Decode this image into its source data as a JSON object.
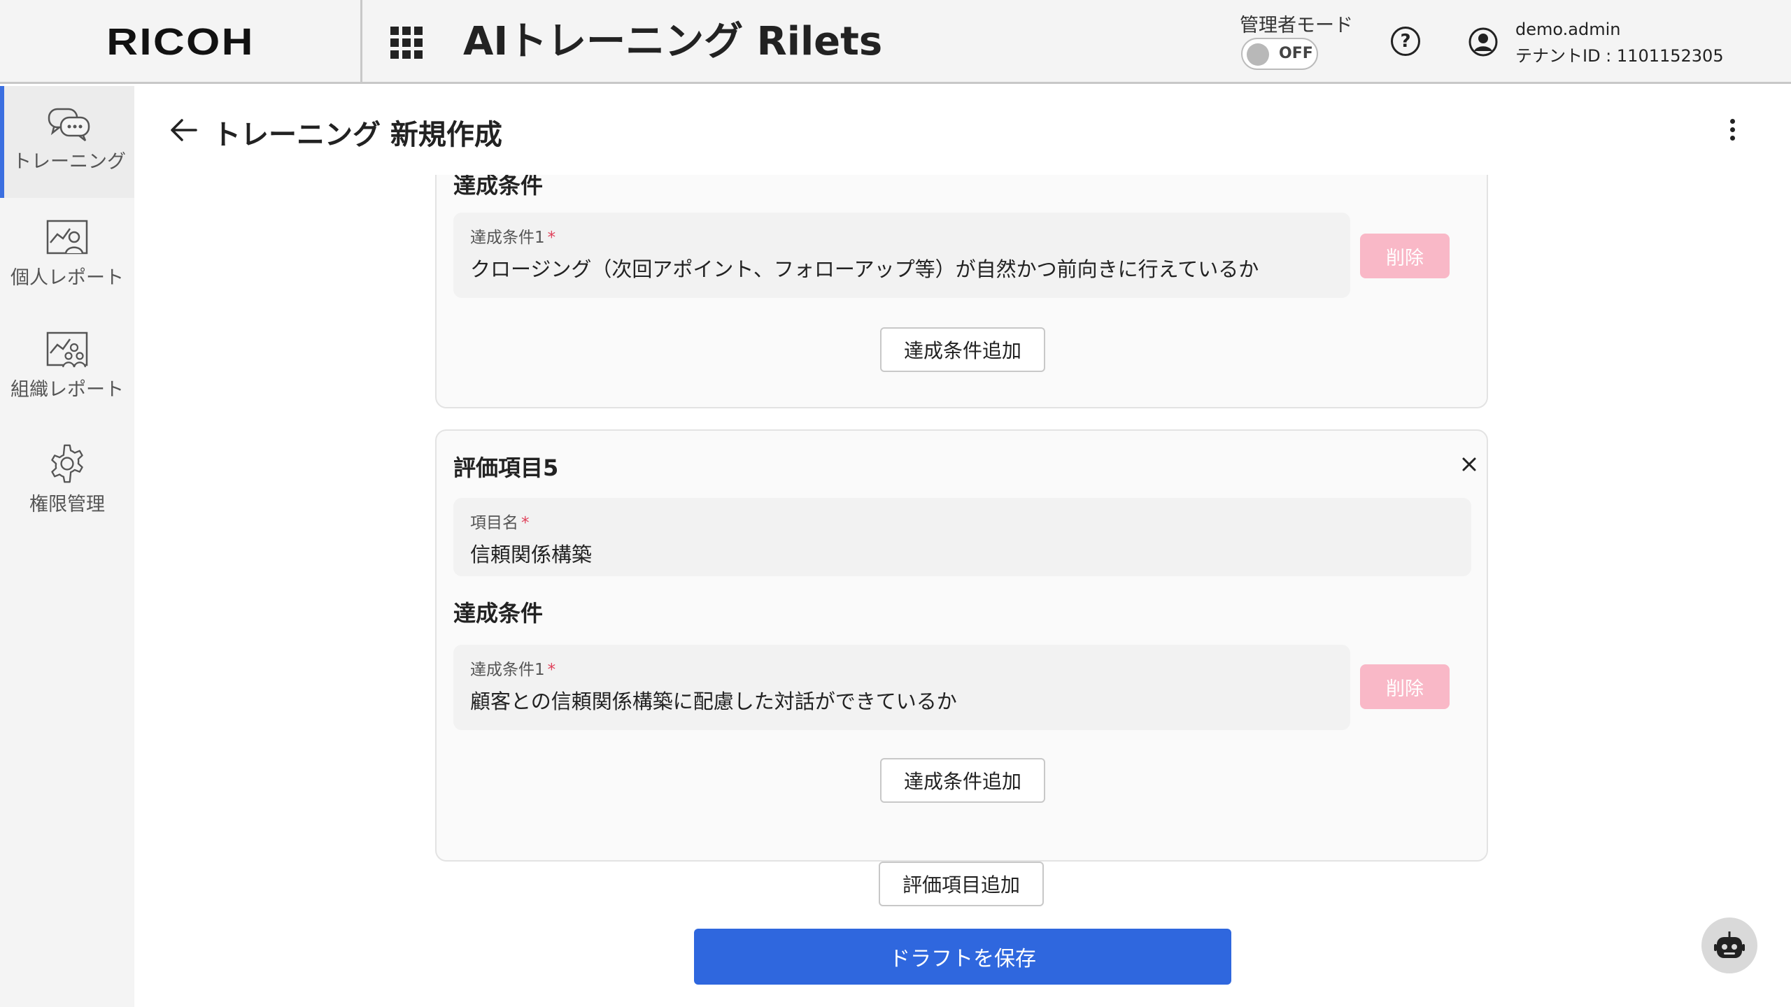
{
  "header": {
    "brand": "RICOH",
    "app_title": "AIトレーニング Rilets",
    "admin_mode_label": "管理者モード",
    "admin_toggle_state": "OFF",
    "help_glyph": "?",
    "user_name": "demo.admin",
    "tenant_id": "テナントID : 1101152305"
  },
  "sidebar": {
    "items": [
      {
        "label": "トレーニング",
        "icon": "chat-bubbles-icon",
        "active": true
      },
      {
        "label": "個人レポート",
        "icon": "person-chart-icon",
        "active": false
      },
      {
        "label": "組織レポート",
        "icon": "group-chart-icon",
        "active": false
      },
      {
        "label": "権限管理",
        "icon": "gear-icon",
        "active": false
      }
    ]
  },
  "page": {
    "title": "トレーニング 新規作成"
  },
  "card_prev": {
    "section_title": "達成条件",
    "condition_label": "達成条件1",
    "required_mark": "*",
    "condition_value": "クロージング（次回アポイント、フォローアップ等）が自然かつ前向きに行えているか",
    "delete_label": "削除",
    "add_condition_label": "達成条件追加"
  },
  "card_item5": {
    "title": "評価項目5",
    "item_name_label": "項目名",
    "required_mark": "*",
    "item_name_value": "信頼関係構築",
    "section_title": "達成条件",
    "condition_label": "達成条件1",
    "condition_value": "顧客との信頼関係構築に配慮した対話ができているか",
    "delete_label": "削除",
    "add_condition_label": "達成条件追加"
  },
  "actions": {
    "add_item_label": "評価項目追加",
    "save_draft_label": "ドラフトを保存"
  },
  "colors": {
    "primary": "#2f67de",
    "active_indicator": "#3b6fe0",
    "delete_disabled": "#f9b8c7",
    "required": "#e0425b"
  }
}
